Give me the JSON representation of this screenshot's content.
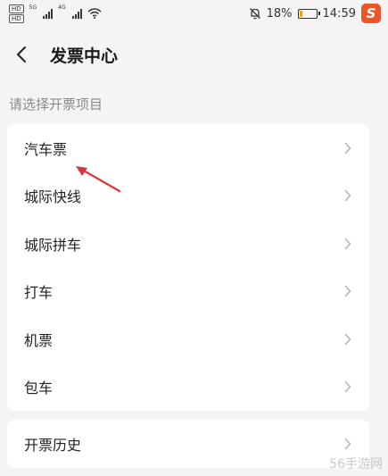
{
  "status_bar": {
    "hd_badges": [
      "HD",
      "HD"
    ],
    "network_labels": [
      "5G",
      "4G"
    ],
    "battery_percent": "18%",
    "battery_level": 0.18,
    "time": "14:59",
    "icons": [
      "mute-icon",
      "battery-icon",
      "wifi-icon",
      "signal-icon"
    ]
  },
  "brand_logo": "S",
  "header": {
    "title": "发票中心",
    "back_icon": "chevron-left-icon"
  },
  "section_label": "请选择开票项目",
  "invoice_items": [
    {
      "label": "汽车票"
    },
    {
      "label": "城际快线"
    },
    {
      "label": "城际拼车"
    },
    {
      "label": "打车"
    },
    {
      "label": "机票"
    },
    {
      "label": "包车"
    }
  ],
  "history": {
    "label": "开票历史"
  },
  "colors": {
    "background": "#f4f4f6",
    "card": "#ffffff",
    "annotation_arrow": "#d9363e",
    "battery": "#f0a000",
    "brand": "#e8562a"
  },
  "watermark": "56手游网"
}
